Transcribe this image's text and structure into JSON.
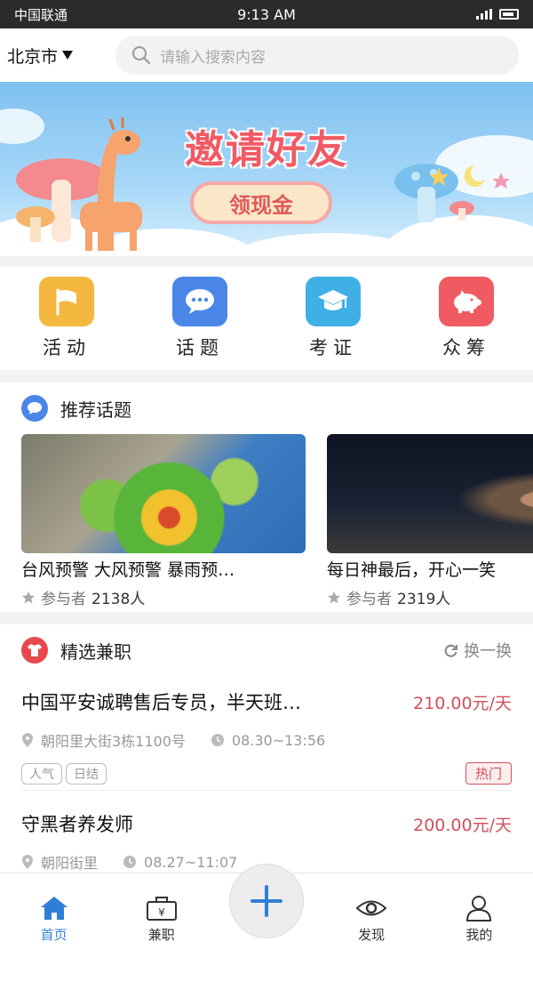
{
  "status_bar": {
    "carrier": "中国联通",
    "time": "9:13 AM"
  },
  "header": {
    "city": "北京市",
    "search_placeholder": "请输入搜索内容"
  },
  "banner": {
    "title": "邀请好友",
    "button": "领现金"
  },
  "quick_entries": [
    {
      "label": "活动",
      "icon": "flag-icon",
      "color": "#f4b73f"
    },
    {
      "label": "话题",
      "icon": "chat-bubble-icon",
      "color": "#4a86e8"
    },
    {
      "label": "考证",
      "icon": "graduation-cap-icon",
      "color": "#3fb0e6"
    },
    {
      "label": "众筹",
      "icon": "piggy-bank-icon",
      "color": "#ef5b60"
    }
  ],
  "recommended_topics": {
    "heading": "推荐话题",
    "items": [
      {
        "title": "台风预警 大风预警 暴雨预…",
        "meta_label": "参与者",
        "count": "2138人"
      },
      {
        "title": "每日神最后，开心一笑",
        "meta_label": "参与者",
        "count": "2319人"
      }
    ]
  },
  "featured_jobs": {
    "heading": "精选兼职",
    "refresh": "换一换",
    "items": [
      {
        "title": "中国平安诚聘售后专员，半天班…",
        "pay": "210.00元/天",
        "location": "朝阳里大街3栋1100号",
        "time": "08.30~13:56",
        "tags": [
          "人气",
          "日结"
        ],
        "badge": "热门"
      },
      {
        "title": "守黑者养发师",
        "pay": "200.00元/天",
        "location": "朝阳街里",
        "time": "08.27~11:07"
      }
    ]
  },
  "tab_bar": [
    {
      "label": "首页",
      "active": true
    },
    {
      "label": "兼职",
      "active": false
    },
    {
      "label": "发现",
      "active": false
    },
    {
      "label": "我的",
      "active": false
    }
  ]
}
